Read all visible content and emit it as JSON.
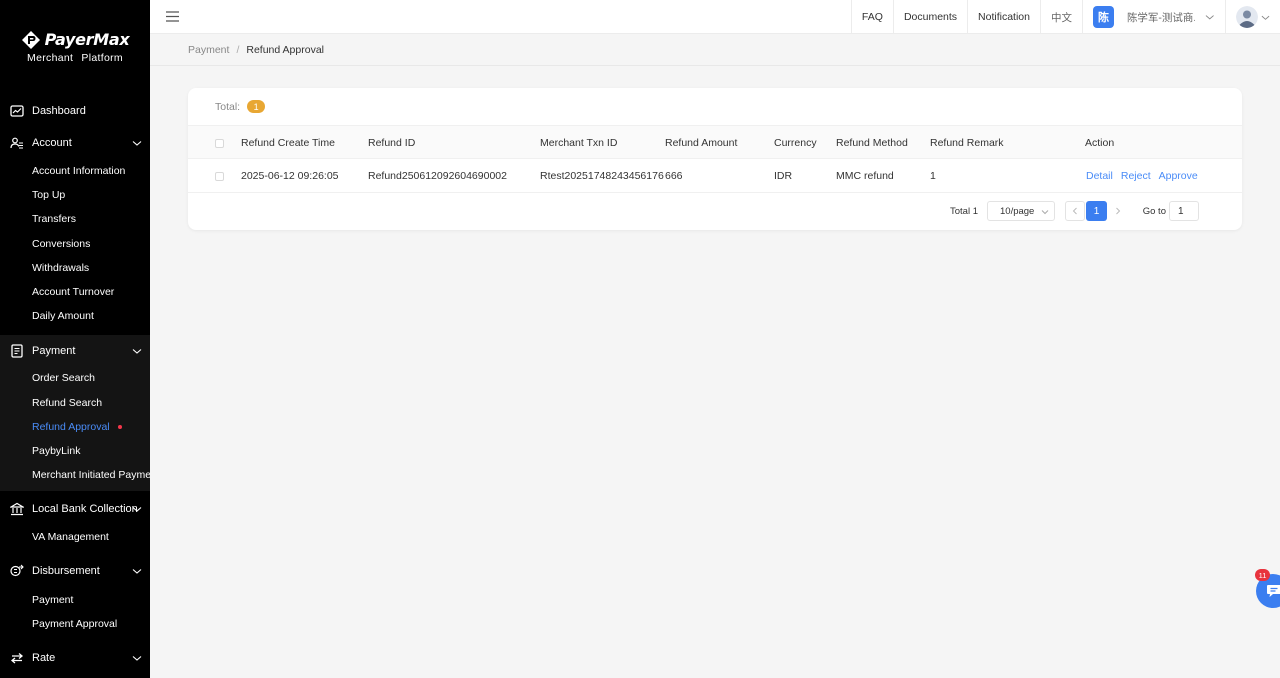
{
  "brand": {
    "name": "PayerMax",
    "subtitle": "Merchant Platform"
  },
  "sidebar": {
    "dashboard": "Dashboard",
    "account": {
      "label": "Account",
      "items": [
        "Account Information",
        "Top Up",
        "Transfers",
        "Conversions",
        "Withdrawals",
        "Account Turnover",
        "Daily Amount"
      ]
    },
    "payment": {
      "label": "Payment",
      "items": [
        "Order Search",
        "Refund Search",
        "Refund Approval",
        "PaybyLink",
        "Merchant Initiated Payment"
      ],
      "active": "Refund Approval"
    },
    "local_bank": {
      "label": "Local Bank Collection",
      "items": [
        "VA Management"
      ]
    },
    "disbursement": {
      "label": "Disbursement",
      "items": [
        "Payment",
        "Payment Approval"
      ]
    },
    "rate": {
      "label": "Rate"
    }
  },
  "header": {
    "faq": "FAQ",
    "documents": "Documents",
    "notification": "Notification",
    "language": "中文",
    "user_initial": "陈",
    "user_name": "陈学军-测试商..."
  },
  "breadcrumb": {
    "parent": "Payment",
    "separator": "/",
    "current": "Refund Approval"
  },
  "summary": {
    "total_label": "Total:",
    "total_count": "1"
  },
  "table": {
    "columns": [
      "Refund Create Time",
      "Refund ID",
      "Merchant Txn ID",
      "Refund Amount",
      "Currency",
      "Refund Method",
      "Refund Remark",
      "Action"
    ],
    "rows": [
      {
        "create_time": "2025-06-12 09:26:05",
        "refund_id": "Refund250612092604690002",
        "merchant_txn_id": "Rtest20251748243456176",
        "amount": "666",
        "currency": "IDR",
        "method": "MMC refund",
        "remark": "1",
        "actions": [
          "Detail",
          "Reject",
          "Approve"
        ]
      }
    ]
  },
  "pagination": {
    "total_text": "Total 1",
    "page_size": "10/page",
    "current_page": "1",
    "goto_label": "Go to",
    "goto_value": "1"
  },
  "chat": {
    "badge": "11"
  },
  "colors": {
    "accent": "#3b7ef0",
    "link": "#4a8cf7",
    "badge": "#e8a733",
    "alert": "#e8333e"
  }
}
